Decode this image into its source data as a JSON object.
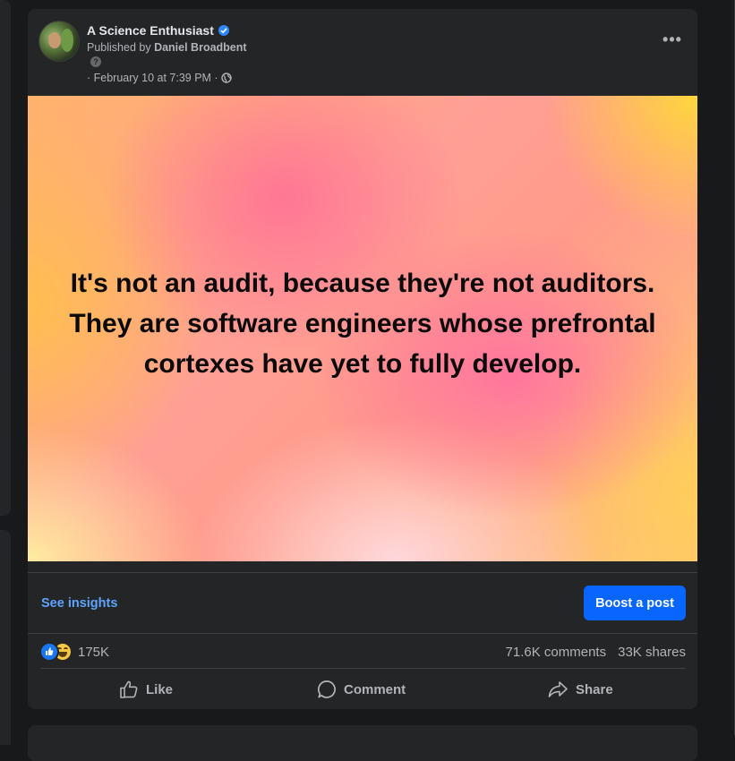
{
  "post": {
    "page_name": "A Science Enthusiast",
    "published_by_prefix": "Published by",
    "published_by_name": "Daniel Broadbent",
    "info_glyph": "?",
    "time": "· February 10 at 7:39 PM ·",
    "more_glyph": "•••",
    "quote_text": "It's not an audit, because they're not auditors. They are software engineers whose prefrontal cortexes have yet to fully develop."
  },
  "insights": {
    "see_insights_label": "See insights",
    "boost_label": "Boost a post"
  },
  "stats": {
    "reaction_count": "175K",
    "comments": "71.6K comments",
    "shares": "33K shares"
  },
  "actions": {
    "like_label": "Like",
    "comment_label": "Comment",
    "share_label": "Share"
  },
  "icons": {
    "verified": "verified-badge-icon",
    "info": "info-icon",
    "privacy": "globe-icon",
    "more": "more-options-icon",
    "like_reaction": "like-reaction-icon",
    "haha_reaction": "haha-reaction-icon",
    "like": "thumbs-up-icon",
    "comment": "comment-bubble-icon",
    "share": "share-arrow-icon"
  },
  "colors": {
    "background": "#18191a",
    "card": "#242526",
    "accent_blue": "#0866ff",
    "link_blue": "#5ea4ff",
    "muted_text": "#b0b3b8"
  }
}
